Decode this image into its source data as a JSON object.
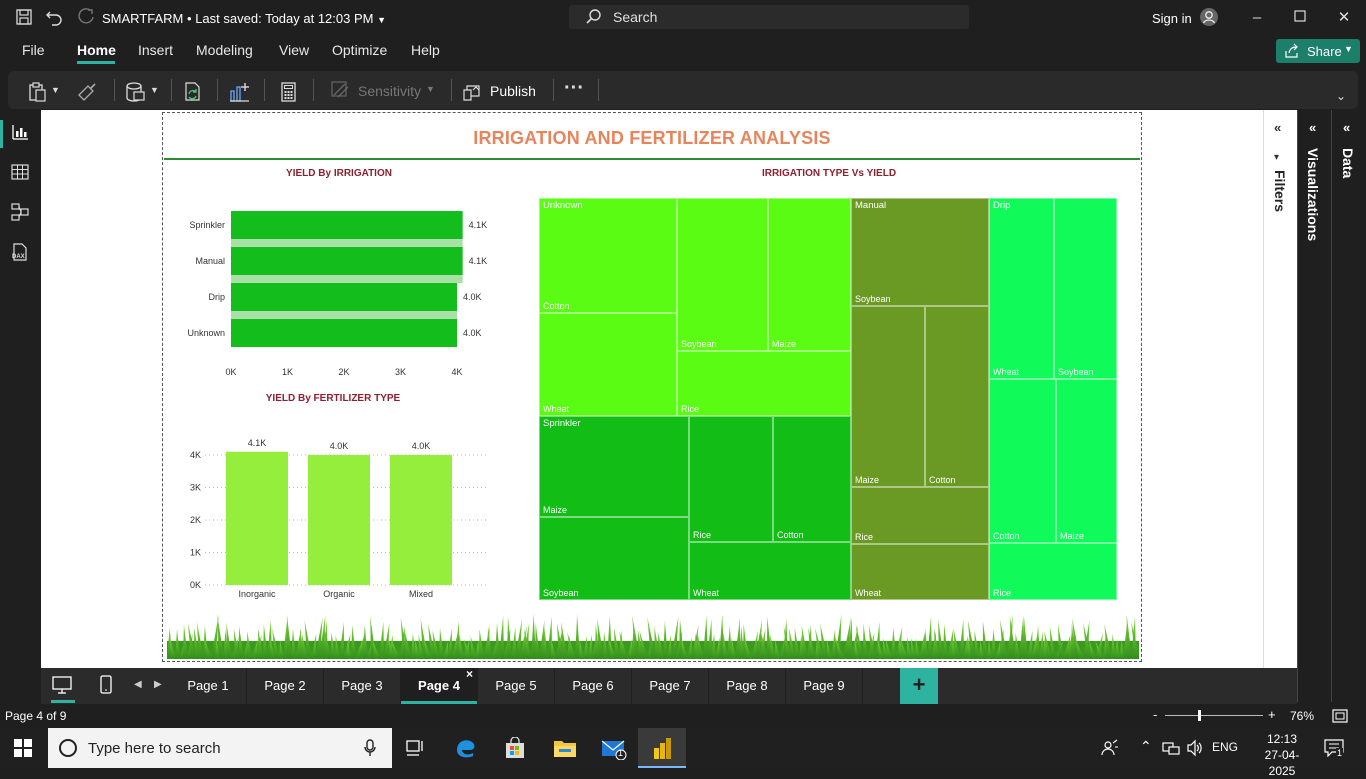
{
  "app": {
    "title": "SMARTFARM",
    "saved": "Last saved: Today at 12:03 PM",
    "search_label": "Search",
    "sign_in": "Sign in"
  },
  "menu": [
    "File",
    "Home",
    "Insert",
    "Modeling",
    "View",
    "Optimize",
    "Help"
  ],
  "share_label": "Share",
  "ribbon": {
    "sensitivity_label": "Sensitivity",
    "publish_label": "Publish",
    "more_label": "···"
  },
  "panes": {
    "filters_label": "Filters",
    "visualizations_label": "Visualizations",
    "data_label": "Data"
  },
  "report": {
    "title": "IRRIGATION AND FERTILIZER ANALYSIS",
    "accent_color": "#e8845c"
  },
  "chart_data": [
    {
      "type": "bar",
      "orientation": "horizontal",
      "title": "YIELD By IRRIGATION",
      "categories": [
        "Sprinkler",
        "Manual",
        "Drip",
        "Unknown"
      ],
      "values": [
        4100,
        4100,
        4000,
        4000
      ],
      "data_labels": [
        "4.1K",
        "4.1K",
        "4.0K",
        "4.0K"
      ],
      "xticks": [
        "0K",
        "1K",
        "2K",
        "3K",
        "4K"
      ],
      "xlim": [
        0,
        4000
      ],
      "color": "#12bd1c"
    },
    {
      "type": "bar",
      "title": "YIELD By FERTILIZER TYPE",
      "categories": [
        "Inorganic",
        "Organic",
        "Mixed"
      ],
      "values": [
        4100,
        4000,
        4000
      ],
      "data_labels": [
        "4.1K",
        "4.0K",
        "4.0K"
      ],
      "yticks": [
        "0K",
        "1K",
        "2K",
        "3K",
        "4K"
      ],
      "ylim": [
        0,
        4000
      ],
      "color": "#96ee3c"
    },
    {
      "type": "treemap",
      "title": "IRRIGATION TYPE Vs YIELD",
      "groups": [
        {
          "name": "Unknown",
          "color": "#5afc14",
          "children": [
            "Cotton",
            "Soybean",
            "Maize",
            "Wheat",
            "Rice"
          ]
        },
        {
          "name": "Sprinkler",
          "color": "#12bd16",
          "children": [
            "Maize",
            "Rice",
            "Cotton",
            "Soybean",
            "Wheat"
          ]
        },
        {
          "name": "Manual",
          "color": "#6a9a24",
          "children": [
            "Soybean",
            "Maize",
            "Cotton",
            "Rice",
            "Wheat"
          ]
        },
        {
          "name": "Drip",
          "color": "#10fa5a",
          "children": [
            "Wheat",
            "Soybean",
            "Cotton",
            "Maize",
            "Rice"
          ]
        }
      ]
    }
  ],
  "pages": [
    "Page 1",
    "Page 2",
    "Page 3",
    "Page 4",
    "Page 5",
    "Page 6",
    "Page 7",
    "Page 8",
    "Page 9"
  ],
  "active_page": "Page 4",
  "status": {
    "page_indicator": "Page 4 of 9",
    "zoom": "76%"
  },
  "taskbar": {
    "search_placeholder": "Type here to search",
    "lang": "ENG",
    "time": "12:13",
    "date": "27-04-2025",
    "mail_badge": "1",
    "notif_badge": "1"
  }
}
